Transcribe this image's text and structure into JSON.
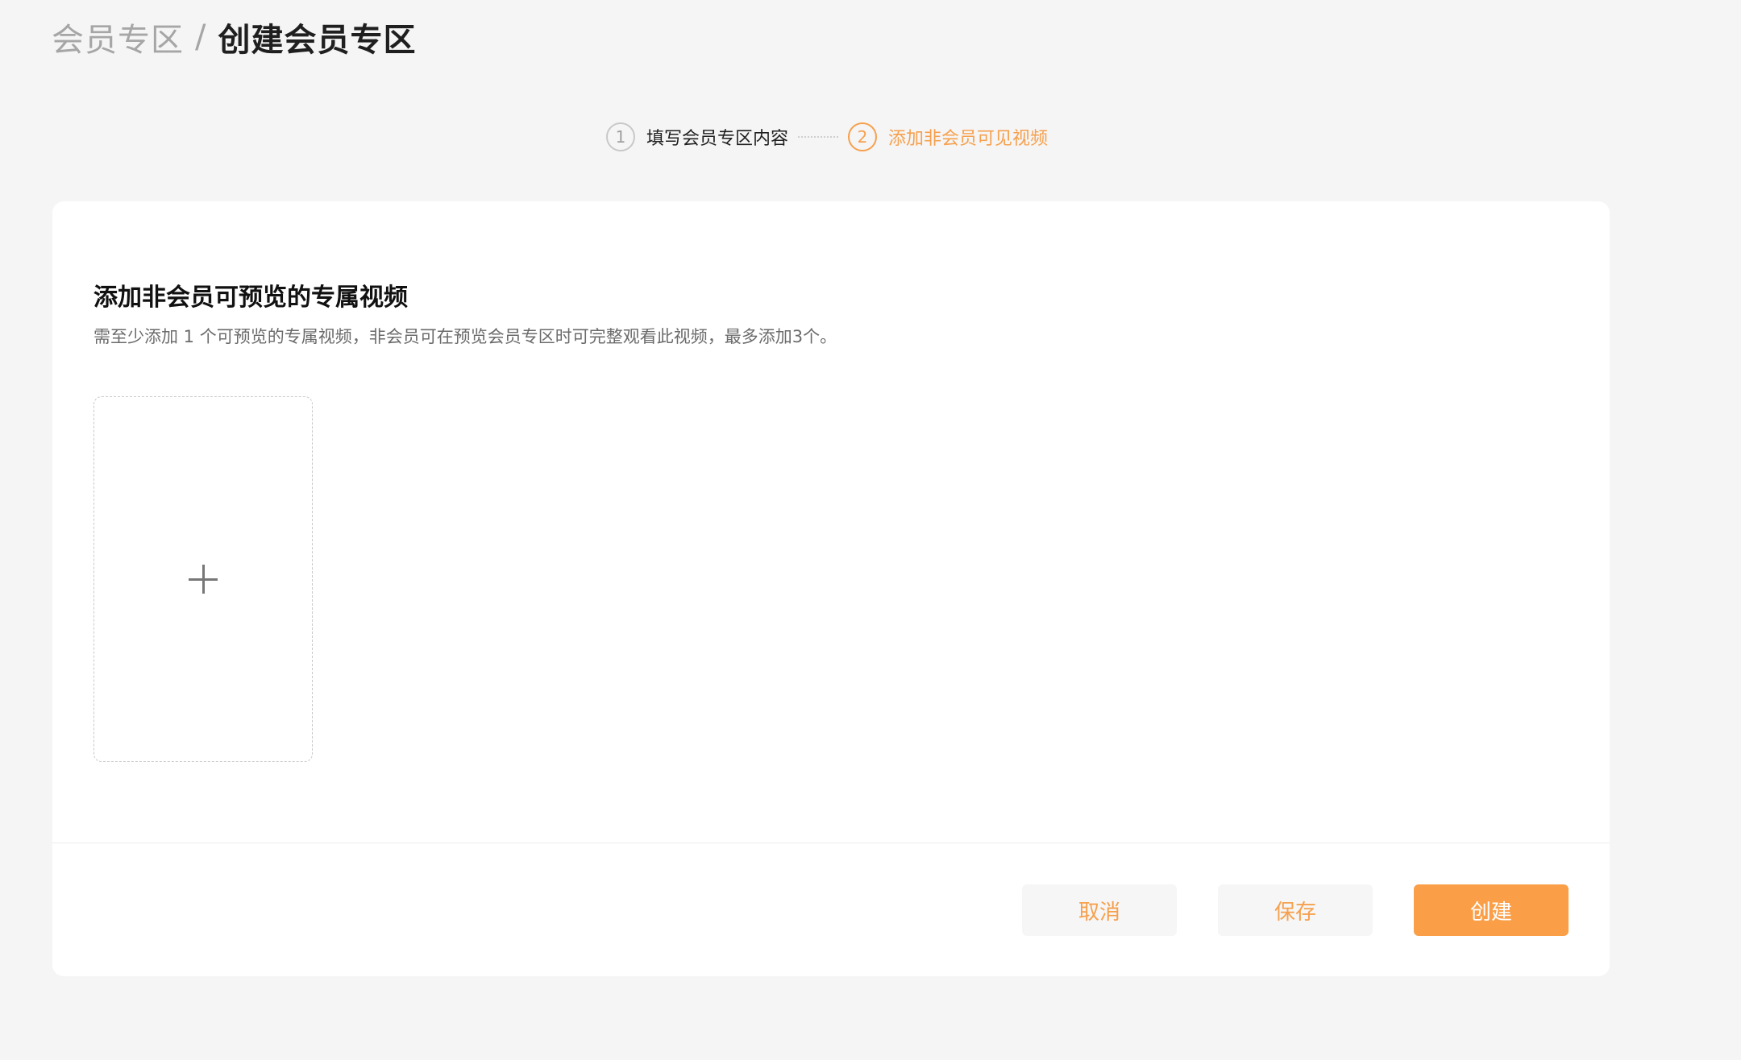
{
  "breadcrumb": {
    "parent": "会员专区",
    "separator": "/",
    "current": "创建会员专区"
  },
  "steps": [
    {
      "number": "1",
      "label": "填写会员专区内容",
      "active": false
    },
    {
      "number": "2",
      "label": "添加非会员可见视频",
      "active": true
    }
  ],
  "section": {
    "title": "添加非会员可预览的专属视频",
    "description": "需至少添加 1 个可预览的专属视频，非会员可在预览会员专区时可完整观看此视频，最多添加3个。"
  },
  "upload": {
    "icon": "plus-icon"
  },
  "actions": {
    "cancel_label": "取消",
    "save_label": "保存",
    "create_label": "创建"
  },
  "colors": {
    "accent": "#fa9f47",
    "background": "#f5f5f5",
    "card": "#ffffff"
  }
}
